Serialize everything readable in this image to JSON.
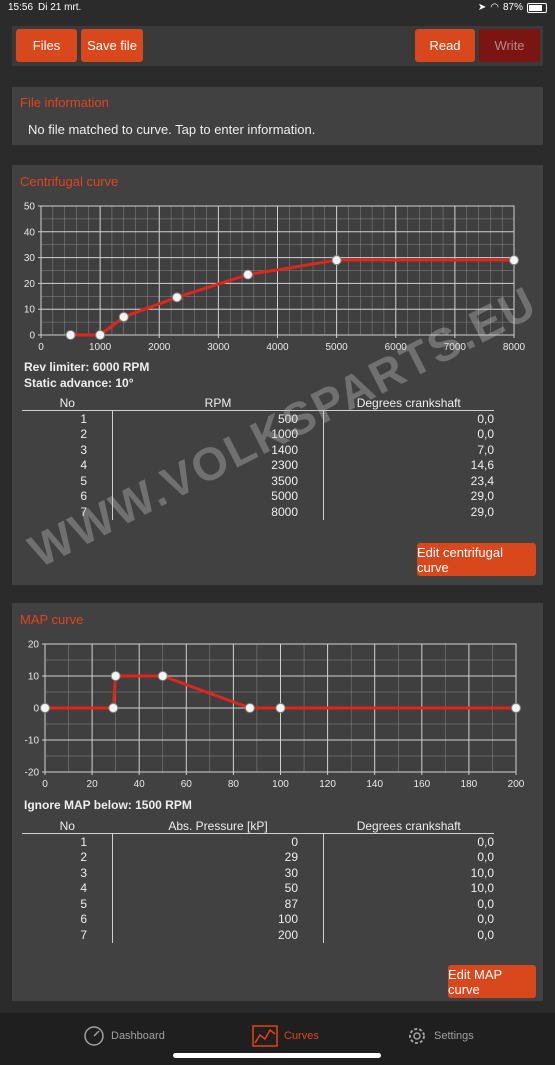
{
  "status_bar": {
    "time": "15:56",
    "date": "Di 21 mrt.",
    "battery": "87%"
  },
  "toolbar": {
    "files": "Files",
    "save_file": "Save file",
    "read": "Read",
    "write": "Write"
  },
  "file_info": {
    "title": "File information",
    "text": "No file matched to curve. Tap to enter information."
  },
  "centrifugal": {
    "title": "Centrifugal curve",
    "rev_limiter": "Rev limiter: 6000 RPM",
    "static_advance": "Static advance: 10°",
    "columns": [
      "No",
      "RPM",
      "Degrees crankshaft"
    ],
    "rows": [
      [
        "1",
        "500",
        "0,0"
      ],
      [
        "2",
        "1000",
        "0,0"
      ],
      [
        "3",
        "1400",
        "7,0"
      ],
      [
        "4",
        "2300",
        "14,6"
      ],
      [
        "5",
        "3500",
        "23,4"
      ],
      [
        "6",
        "5000",
        "29,0"
      ],
      [
        "7",
        "8000",
        "29,0"
      ]
    ],
    "edit_button": "Edit centrifugal curve"
  },
  "map": {
    "title": "MAP curve",
    "ignore_text": "Ignore MAP below: 1500 RPM",
    "columns": [
      "No",
      "Abs. Pressure [kP]",
      "Degrees crankshaft"
    ],
    "rows": [
      [
        "1",
        "0",
        "0,0"
      ],
      [
        "2",
        "29",
        "0,0"
      ],
      [
        "3",
        "30",
        "10,0"
      ],
      [
        "4",
        "50",
        "10,0"
      ],
      [
        "5",
        "87",
        "0,0"
      ],
      [
        "6",
        "100",
        "0,0"
      ],
      [
        "7",
        "200",
        "0,0"
      ]
    ],
    "edit_button": "Edit MAP curve"
  },
  "watermark": "WWW.VOLKSPARTS.EU",
  "tabs": {
    "dashboard": "Dashboard",
    "curves": "Curves",
    "settings": "Settings"
  },
  "colors": {
    "accent": "#d9471d",
    "line": "#e0261a",
    "panel": "#414141"
  },
  "chart_data": [
    {
      "type": "line",
      "title": "Centrifugal curve",
      "xlabel": "",
      "ylabel": "",
      "x": [
        500,
        1000,
        1400,
        2300,
        3500,
        5000,
        8000
      ],
      "y": [
        0,
        0,
        7,
        14.6,
        23.4,
        29,
        29
      ],
      "xlim": [
        0,
        8000
      ],
      "ylim": [
        0,
        50
      ],
      "xticks": [
        0,
        1000,
        2000,
        3000,
        4000,
        5000,
        6000,
        7000,
        8000
      ],
      "yticks": [
        0,
        10,
        20,
        30,
        40,
        50
      ],
      "grid": true
    },
    {
      "type": "line",
      "title": "MAP curve",
      "xlabel": "",
      "ylabel": "",
      "x": [
        0,
        29,
        30,
        50,
        87,
        100,
        200
      ],
      "y": [
        0,
        0,
        10,
        10,
        0,
        0,
        0
      ],
      "xlim": [
        0,
        200
      ],
      "ylim": [
        -20,
        20
      ],
      "xticks": [
        0,
        20,
        40,
        60,
        80,
        100,
        120,
        140,
        160,
        180,
        200
      ],
      "yticks": [
        -20,
        -10,
        0,
        10,
        20
      ],
      "grid": true
    }
  ]
}
